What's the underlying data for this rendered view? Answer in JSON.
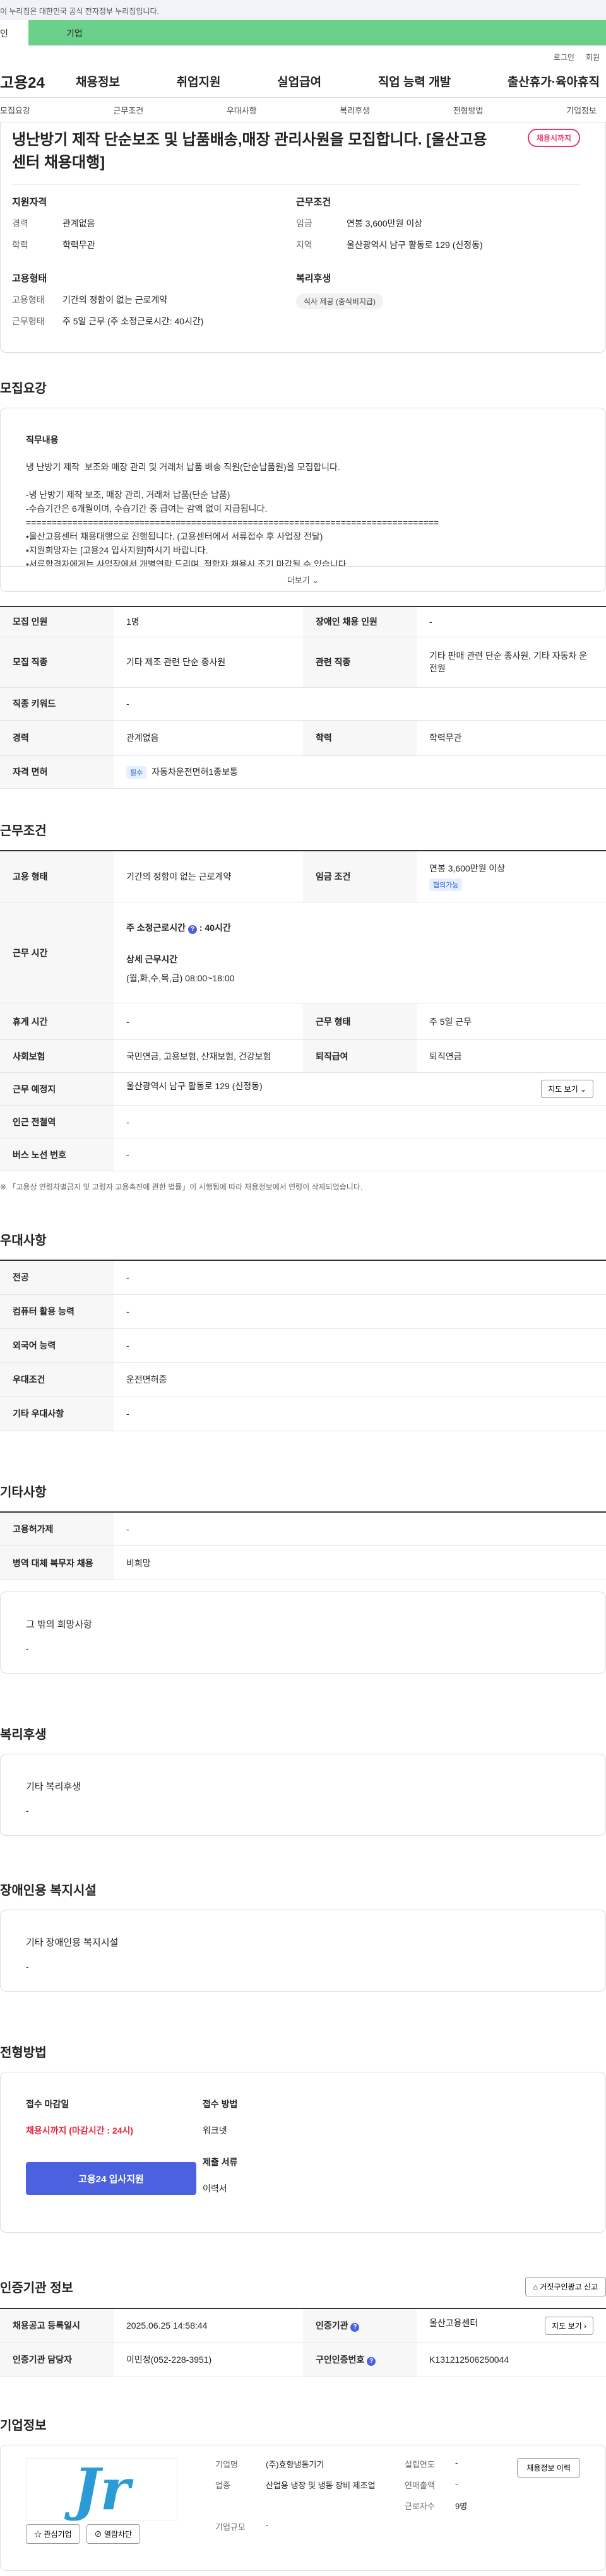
{
  "gov_banner": "이 누리집은 대한민국 공식 전자정부 누리집입니다.",
  "type_bar": {
    "left": "인",
    "right": "기업"
  },
  "util": {
    "login": "로그인",
    "join": "회원"
  },
  "gnb": {
    "logo": "고용24",
    "menu": [
      "채용정보",
      "취업지원",
      "실업급여",
      "직업 능력 개발",
      "출산휴가·육아휴직"
    ]
  },
  "subnav": [
    "모집요강",
    "근무조건",
    "우대사항",
    "복리후생",
    "전형방법",
    "기업정보"
  ],
  "job": {
    "title": "냉난방기 제작 단순보조 및 납품배송,매장 관리사원을 모집합니다. [울산고용센터 채용대행]",
    "badge": "채용시까지",
    "qualify_title": "지원자격",
    "qualify": [
      {
        "k": "경력",
        "v": "관계없음"
      },
      {
        "k": "학력",
        "v": "학력무관"
      }
    ],
    "cond_title": "근무조건",
    "cond": [
      {
        "k": "임금",
        "v": "연봉 3,600만원 이상"
      },
      {
        "k": "지역",
        "v": "울산광역시 남구 활동로 129 (신정동)"
      }
    ],
    "emp_title": "고용형태",
    "emp": [
      {
        "k": "고용형태",
        "v": "기간의 정함이 없는 근로계약"
      },
      {
        "k": "근무형태",
        "v": "주 5일 근무 (주 소정근로시간: 40시간)"
      }
    ],
    "welfare_title": "복리후생",
    "welfare_chip": "식사 제공 (중식비지급)"
  },
  "recruit": {
    "section_title": "모집요강",
    "desc_title": "직무내용",
    "desc_text": "냉 난방기 제작  보조와 매장 관리 및 거래처 납품 배송 직원(단순납품원)을 모집합니다.\n\n-냉 난방기 제작 보조, 매장 관리, 거래처 납품(단순 납품)\n-수습기간은 6개월이며, 수습기간 중 급여는 감액 없이 지급됩니다.\n================================================================================\n•울산고용센터 채용대행으로 진행됩니다. (고용센터에서 서류접수 후 사업장 전달)\n•지원희망자는 [고용24 입사지원]하시기 바랍니다.\n•서류합격자에게는 사업장에서 개별연락 드리며, 적합자 채용시 조기 마감될 수 있습니다.\n•실제 지원의사(면접 및 취업의사) 있는 분만 지원바랍니다.",
    "more": "더보기",
    "rows": [
      {
        "k1": "모집 인원",
        "v1": "1명",
        "k2": "장애인 채용 인원",
        "v2": "-"
      },
      {
        "k1": "모집 직종",
        "v1": "기타 제조 관련 단순 종사원",
        "k2": "관련 직종",
        "v2": "기타 판매 관련 단순 종사원, 기타 자동차 운전원"
      },
      {
        "k1": "직종 키워드",
        "v1": "-",
        "k2": "",
        "v2": ""
      },
      {
        "k1": "경력",
        "v1": "관계없음",
        "k2": "학력",
        "v2": "학력무관"
      }
    ],
    "license_k": "자격 면허",
    "license_tag": "필수",
    "license_v": "자동차운전면허1종보통"
  },
  "work": {
    "section_title": "근무조건",
    "emp_k": "고용 형태",
    "emp_v": "기간의 정함이 없는 근로계약",
    "wage_k": "임금 조건",
    "wage_v": "연봉 3,600만원 이상",
    "wage_tag": "협의가능",
    "time_k": "근무 시간",
    "time_main": "주 소정근로시간",
    "time_hours": ": 40시간",
    "time_detail_title": "상세 근무시간",
    "time_detail": "(월,화,수,목,금) 08:00~18:00",
    "rest_k": "휴게 시간",
    "rest_v": "-",
    "form_k": "근무 형태",
    "form_v": "주 5일 근무",
    "ins_k": "사회보험",
    "ins_v": "국민연금, 고용보험, 산재보험, 건강보험",
    "ret_k": "퇴직급여",
    "ret_v": "퇴직연금",
    "place_k": "근무 예정지",
    "place_v": "울산광역시 남구 활동로 129 (신정동)",
    "map_btn": "지도 보기",
    "sub_k": "인근 전철역",
    "sub_v": "-",
    "bus_k": "버스 노선 번호",
    "bus_v": "-",
    "footnote": "「고용상 연령차별금지 및 고령자 고용촉진에 관한 법률」이 시행됨에 따라 채용정보에서 연령이 삭제되었습니다."
  },
  "pref": {
    "section_title": "우대사항",
    "rows": [
      {
        "k": "전공",
        "v": "-"
      },
      {
        "k": "컴퓨터 활용 능력",
        "v": "-"
      },
      {
        "k": "외국어 능력",
        "v": "-"
      },
      {
        "k": "우대조건",
        "v": "운전면허증"
      },
      {
        "k": "기타 우대사항",
        "v": "-"
      }
    ]
  },
  "etc": {
    "section_title": "기타사항",
    "rows": [
      {
        "k": "고용허가제",
        "v": "-"
      },
      {
        "k": "병역 대체 복무자 채용",
        "v": "비희망"
      }
    ],
    "box_title": "그 밖의 희망사항",
    "box_value": "-"
  },
  "welfare": {
    "section_title": "복리후생",
    "box_title": "기타 복리후생",
    "box_value": "-"
  },
  "disabled": {
    "section_title": "장애인용 복지시설",
    "box_title": "기타 장애인용 복지시설",
    "box_value": "-"
  },
  "process": {
    "section_title": "전형방법",
    "deadline_title": "접수 마감일",
    "deadline_value": "채용시까지 (마감시간 : 24시)",
    "method_title": "접수 방법",
    "method_value": "워크넷",
    "docs_title": "제출 서류",
    "docs_value": "이력서",
    "apply_btn": "고용24 입사지원"
  },
  "cert": {
    "section_title": "인증기관 정보",
    "report_btn": "거짓구인광고 신고",
    "reg_k": "채용공고 등록일시",
    "reg_v": "2025.06.25 14:58:44",
    "org_k": "인증기관",
    "org_v": "울산고용센터",
    "map_btn": "지도 보기",
    "mgr_k": "인증기관 담당자",
    "mgr_v": "이민정(052-228-3951)",
    "id_k": "구인인증번호",
    "id_v": "K131212506250044"
  },
  "company": {
    "section_title": "기업정보",
    "logo_text": "Jr",
    "fav_btn": "관심기업",
    "block_btn": "열람차단",
    "hist_btn": "채용정보 이력",
    "fields": [
      {
        "k": "기업명",
        "v": "(주)효향냉동기기"
      },
      {
        "k": "설립연도",
        "v": "-"
      },
      {
        "k": "업종",
        "v": "산업용 냉장 및 냉동 장비 제조업"
      },
      {
        "k": "연매출액",
        "v": "-"
      },
      {
        "k": "",
        "v": ""
      },
      {
        "k": "근로자수",
        "v": "9명"
      },
      {
        "k": "기업규모",
        "v": "-"
      }
    ]
  }
}
